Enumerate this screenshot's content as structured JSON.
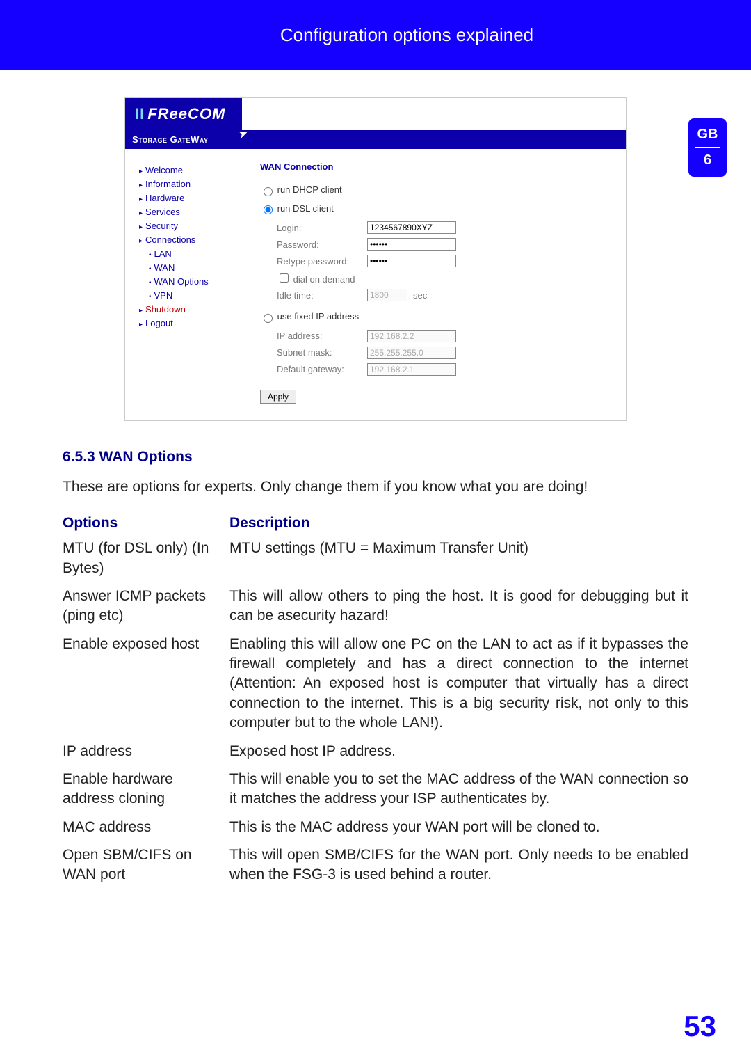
{
  "header": {
    "title": "Configuration options explained"
  },
  "sideTab": {
    "top": "GB",
    "bottom": "6"
  },
  "screenshot": {
    "logo_prefix": "II",
    "logo_text": "FReeCOM",
    "subhead": "Storage GateWay",
    "sidebar": [
      {
        "label": "Welcome",
        "sub": false,
        "red": false
      },
      {
        "label": "Information",
        "sub": false,
        "red": false
      },
      {
        "label": "Hardware",
        "sub": false,
        "red": false
      },
      {
        "label": "Services",
        "sub": false,
        "red": false
      },
      {
        "label": "Security",
        "sub": false,
        "red": false
      },
      {
        "label": "Connections",
        "sub": false,
        "red": false
      },
      {
        "label": "LAN",
        "sub": true,
        "red": false
      },
      {
        "label": "WAN",
        "sub": true,
        "red": false
      },
      {
        "label": "WAN Options",
        "sub": true,
        "red": false
      },
      {
        "label": "VPN",
        "sub": true,
        "red": false
      },
      {
        "label": "Shutdown",
        "sub": false,
        "red": true
      },
      {
        "label": "Logout",
        "sub": false,
        "red": false
      }
    ],
    "main": {
      "heading": "WAN Connection",
      "radio_dhcp": "run DHCP client",
      "radio_dsl": "run DSL client",
      "login_label": "Login:",
      "login_value": "1234567890XYZ",
      "password_label": "Password:",
      "password_value": "••••••",
      "retype_label": "Retype password:",
      "retype_value": "••••••",
      "dial_label": "dial on demand",
      "idle_label": "Idle time:",
      "idle_value": "1800",
      "idle_unit": "sec",
      "radio_fixed": "use fixed IP address",
      "ip_label": "IP address:",
      "ip_value": "192.168.2.2",
      "subnet_label": "Subnet mask:",
      "subnet_value": "255.255.255.0",
      "gw_label": "Default gateway:",
      "gw_value": "192.168.2.1",
      "apply": "Apply"
    }
  },
  "doc": {
    "section_heading": "6.5.3 WAN Options",
    "intro": "These are options for experts. Only change them if you know what you are doing!",
    "th_options": "Options",
    "th_desc": "Description",
    "rows": [
      {
        "opt": "MTU (for DSL only) (In Bytes)",
        "desc": "MTU settings (MTU = Maximum Transfer Unit)"
      },
      {
        "opt": "Answer ICMP packets (ping etc)",
        "desc": "This will allow others to ping the host. It is good for debugging but it can be asecurity hazard!"
      },
      {
        "opt": "Enable exposed host",
        "desc": "Enabling this will allow one PC on the LAN to act as if it bypasses the firewall completely and has a direct connection to the internet (Attention: An exposed host is computer that virtually has a direct connection to the internet. This is a big security risk, not only to this computer but to the whole LAN!)."
      },
      {
        "opt": "IP address",
        "desc": "Exposed host IP address."
      },
      {
        "opt": "Enable hardware address cloning",
        "desc": "This will enable you to set the MAC address of the WAN connection so it matches the address your ISP authenticates by."
      },
      {
        "opt": "MAC address",
        "desc": "This is the MAC address your WAN port will be cloned to."
      },
      {
        "opt": "Open SBM/CIFS on WAN port",
        "desc": "This will open SMB/CIFS for the WAN port. Only needs to be enabled  when the FSG-3 is used behind a router."
      }
    ]
  },
  "page_number": "53"
}
